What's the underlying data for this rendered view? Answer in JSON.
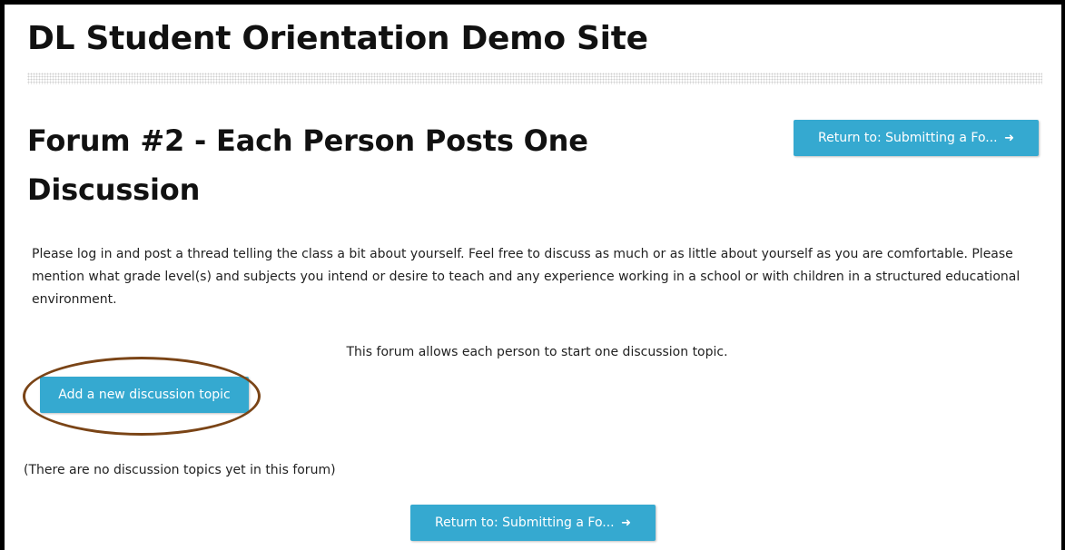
{
  "site": {
    "title": "DL Student Orientation Demo Site"
  },
  "forum": {
    "title": "Forum #2 - Each Person Posts One Discussion",
    "intro": "Please log in and post a thread telling the class a bit about yourself.  Feel free to discuss as much or as little about yourself as you are comfortable.  Please mention what grade level(s) and subjects you intend or desire to teach and any experience working in a school or with children in a structured educational environment.",
    "allows_text": "This forum allows each person to start one discussion topic.",
    "add_topic_label": "Add a new discussion topic",
    "no_topics_text": "(There are no discussion topics yet in this forum)"
  },
  "navigation": {
    "return_label": "Return to: Submitting a Fo...",
    "return_icon": "arrow-right-icon"
  },
  "colors": {
    "button_bg": "#35a9d0",
    "button_text": "#ffffff",
    "highlight_ring": "#7a4416",
    "frame": "#000000"
  }
}
